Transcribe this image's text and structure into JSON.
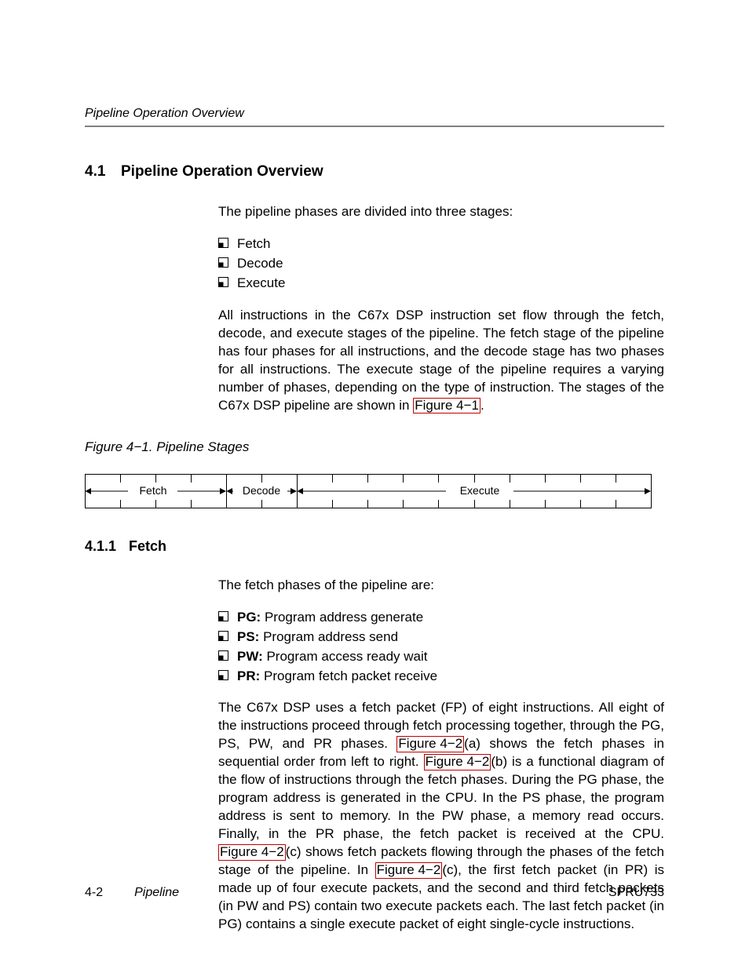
{
  "header": {
    "running": "Pipeline Operation Overview"
  },
  "section": {
    "number": "4.1",
    "title": "Pipeline Operation Overview",
    "intro": "The pipeline phases are divided into three stages:",
    "stages": [
      "Fetch",
      "Decode",
      "Execute"
    ],
    "para1_a": "All instructions in the C67x DSP instruction set flow through the fetch, decode, and execute stages of the pipeline. The fetch stage of the pipeline has four phases for all instructions, and the decode stage has two phases for all instructions. The execute stage of the pipeline requires a varying number of phases, depending on the type of instruction. The stages of the C67x DSP pipeline are shown in ",
    "para1_link": "Figure 4−1",
    "para1_b": "."
  },
  "figure": {
    "caption": "Figure 4−1.  Pipeline Stages",
    "labels": {
      "fetch": "Fetch",
      "decode": "Decode",
      "execute": "Execute"
    }
  },
  "chart_data": {
    "type": "table",
    "title": "Pipeline Stages",
    "series": [
      {
        "name": "Fetch",
        "phases": 4
      },
      {
        "name": "Decode",
        "phases": 2
      },
      {
        "name": "Execute",
        "phases": 10
      }
    ],
    "total_phases": 16
  },
  "subsection": {
    "number": "4.1.1",
    "title": "Fetch",
    "intro": "The fetch phases of the pipeline are:",
    "phases": [
      {
        "code": "PG:",
        "desc": " Program address generate"
      },
      {
        "code": "PS:",
        "desc": " Program address send"
      },
      {
        "code": "PW:",
        "desc": " Program access ready wait"
      },
      {
        "code": "PR:",
        "desc": " Program fetch packet receive"
      }
    ],
    "para_a": "The C67x DSP uses a fetch packet (FP) of eight instructions. All eight of the instructions proceed through fetch processing together, through the PG, PS, PW, and PR phases. ",
    "link1": "Figure 4−2",
    "para_b": "(a) shows the fetch phases in sequential order from left to right. ",
    "link2": "Figure 4−2",
    "para_c": "(b) is a functional diagram of the flow of instructions through the fetch phases. During the PG phase, the program address is generated in the CPU. In the PS phase, the program address is sent to memory. In the PW phase, a memory read occurs. Finally, in the PR phase, the fetch packet is received at the CPU. ",
    "link3": "Figure 4−2",
    "para_d": "(c) shows fetch packets flowing through the phases of the fetch stage of the pipeline. In ",
    "link4": "Figure 4−2",
    "para_e": "(c), the first fetch packet (in PR) is made up of four execute packets, and the second and third fetch packets (in PW and PS) contain two execute packets each. The last fetch packet (in PG) contains a single execute packet of eight single-cycle instructions."
  },
  "footer": {
    "page": "4-2",
    "chapter": "Pipeline",
    "docnum": "SPRU733"
  }
}
